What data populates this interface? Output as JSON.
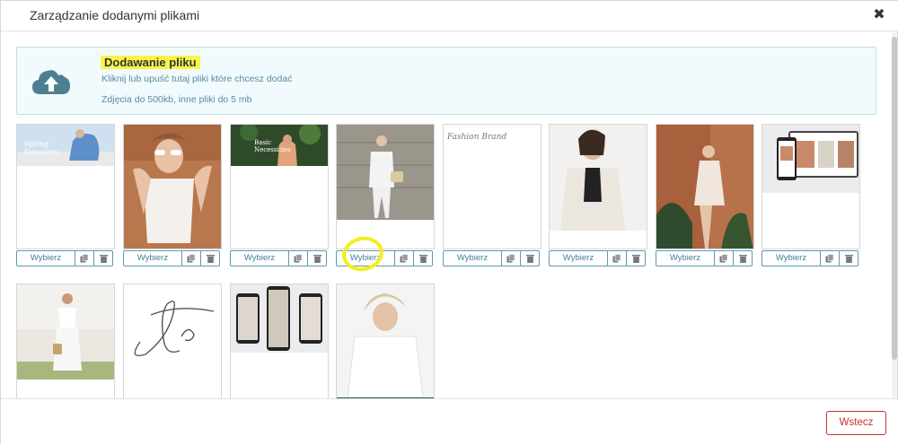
{
  "modal": {
    "title": "Zarządzanie dodanymi plikami",
    "close_icon": "close-icon"
  },
  "dropzone": {
    "title": "Dodawanie pliku",
    "instruction": "Kliknij lub upuść tutaj pliki które chcesz dodać",
    "limits": "Zdjęcia do 500kb, inne pliki do 5 mb",
    "icon": "cloud-upload-icon"
  },
  "files": {
    "select_label": "Wybierz",
    "copy_icon": "copy-icon",
    "delete_icon": "trash-icon",
    "items": [
      {
        "thumb_text_1": "Spring",
        "thumb_text_2": "Sweaters"
      },
      {
        "thumb_text_1": "",
        "thumb_text_2": ""
      },
      {
        "thumb_text_1": "Basic",
        "thumb_text_2": "Necessities"
      },
      {
        "thumb_text_1": "",
        "thumb_text_2": ""
      },
      {
        "thumb_text_1": "Fashion Brand",
        "thumb_text_2": ""
      },
      {
        "thumb_text_1": "",
        "thumb_text_2": ""
      },
      {
        "thumb_text_1": "",
        "thumb_text_2": ""
      },
      {
        "thumb_text_1": "",
        "thumb_text_2": ""
      },
      {
        "thumb_text_1": "",
        "thumb_text_2": ""
      },
      {
        "thumb_text_1": "",
        "thumb_text_2": ""
      },
      {
        "thumb_text_1": "",
        "thumb_text_2": ""
      },
      {
        "thumb_text_1": "",
        "thumb_text_2": ""
      }
    ]
  },
  "footer": {
    "back_label": "Wstecz"
  },
  "colors": {
    "accent": "#3f7f98",
    "highlight": "#f7f44a",
    "danger": "#c9302c"
  }
}
